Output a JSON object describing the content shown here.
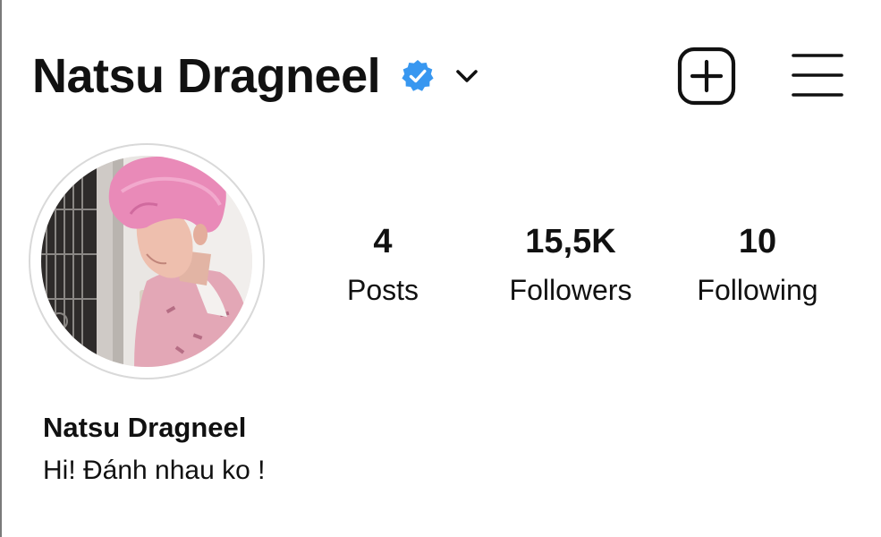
{
  "header": {
    "username": "Natsu Dragneel",
    "verified_icon": "verified-badge-icon",
    "dropdown_icon": "chevron-down-icon",
    "new_post_icon": "plus-square-icon",
    "menu_icon": "hamburger-menu-icon"
  },
  "profile": {
    "avatar_icon": "profile-photo"
  },
  "stats": {
    "posts": {
      "value": "4",
      "label": "Posts"
    },
    "followers": {
      "value": "15,5K",
      "label": "Followers"
    },
    "following": {
      "value": "10",
      "label": "Following"
    }
  },
  "bio": {
    "display_name": "Natsu Dragneel",
    "text": "Hi! Đánh nhau ko !"
  },
  "colors": {
    "verified_blue": "#3897f0",
    "text": "#111111",
    "ring": "#d9d9d9",
    "hair_pink": "#e98ab8"
  }
}
